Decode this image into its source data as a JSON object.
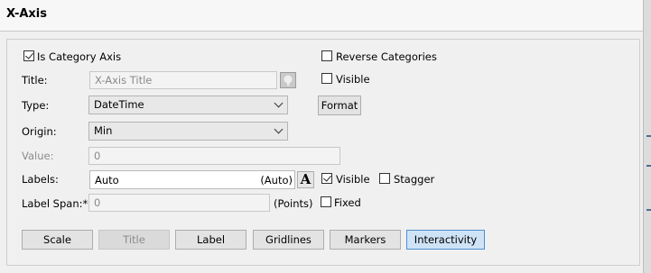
{
  "header": {
    "title": "X-Axis"
  },
  "options": {
    "is_category_axis": {
      "label": "Is Category Axis",
      "checked": true
    },
    "reverse_categories": {
      "label": "Reverse Categories",
      "checked": false
    }
  },
  "title_row": {
    "label": "Title:",
    "placeholder": "X-Axis Title",
    "visible_label": "Visible",
    "visible_checked": false,
    "icon": "font-settings-icon"
  },
  "type_row": {
    "label": "Type:",
    "value": "DateTime",
    "format_button": "Format"
  },
  "origin_row": {
    "label": "Origin:",
    "value": "Min"
  },
  "value_row": {
    "label": "Value:",
    "value": "0"
  },
  "labels_row": {
    "label": "Labels:",
    "value": "Auto",
    "suffix": "(Auto)",
    "font_button": "A",
    "visible_label": "Visible",
    "visible_checked": true,
    "stagger_label": "Stagger",
    "stagger_checked": false
  },
  "label_span_row": {
    "label": "Label Span:*",
    "value": "0",
    "unit": "(Points)",
    "fixed_label": "Fixed",
    "fixed_checked": false
  },
  "tabs": [
    {
      "label": "Scale"
    },
    {
      "label": "Title"
    },
    {
      "label": "Label"
    },
    {
      "label": "Gridlines"
    },
    {
      "label": "Markers"
    },
    {
      "label": "Interactivity"
    }
  ],
  "colors": {
    "active_tab_border": "#4f8fcf",
    "active_tab_bg": "#cfe3f7"
  }
}
